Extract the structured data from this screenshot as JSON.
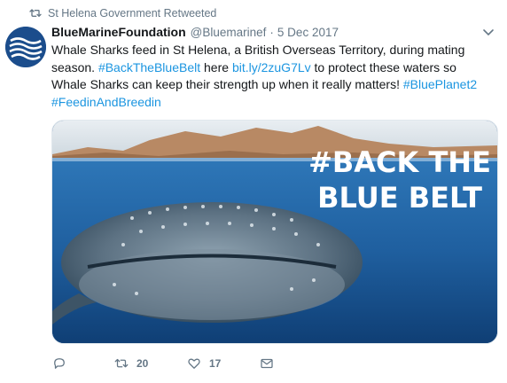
{
  "retweet": {
    "text": "St Helena Government Retweeted",
    "icon": "retweet-icon"
  },
  "author": {
    "name": "BlueMarineFoundation",
    "handle": "@Bluemarinef",
    "separator": "·",
    "date": "5 Dec 2017",
    "avatar_color": "#1b4d8c"
  },
  "tweet": {
    "segments": [
      {
        "text": "Whale Sharks feed in St Helena, a British Overseas Territory, during mating season. ",
        "type": "text"
      },
      {
        "text": "#BackTheBlueBelt",
        "type": "link"
      },
      {
        "text": " here ",
        "type": "text"
      },
      {
        "text": "bit.ly/2zuG7Lv",
        "type": "link"
      },
      {
        "text": " to protect these waters so Whale Sharks can keep their strength up when it really matters! ",
        "type": "text"
      },
      {
        "text": "#BluePlanet2",
        "type": "link"
      },
      {
        "text": " ",
        "type": "text"
      },
      {
        "text": "#FeedinAndBreedin",
        "type": "link"
      }
    ],
    "link_color": "#1b95e0"
  },
  "media": {
    "overlay_line1": "#BACK THE",
    "overlay_line2": "BLUE BELT"
  },
  "actions": {
    "reply": {
      "icon": "reply-icon",
      "count": ""
    },
    "retweet": {
      "icon": "retweet-icon",
      "count": "20"
    },
    "like": {
      "icon": "heart-icon",
      "count": "17"
    },
    "message": {
      "icon": "envelope-icon",
      "count": ""
    }
  },
  "colors": {
    "text": "#14171a",
    "secondary": "#657786",
    "accent": "#1b95e0"
  }
}
